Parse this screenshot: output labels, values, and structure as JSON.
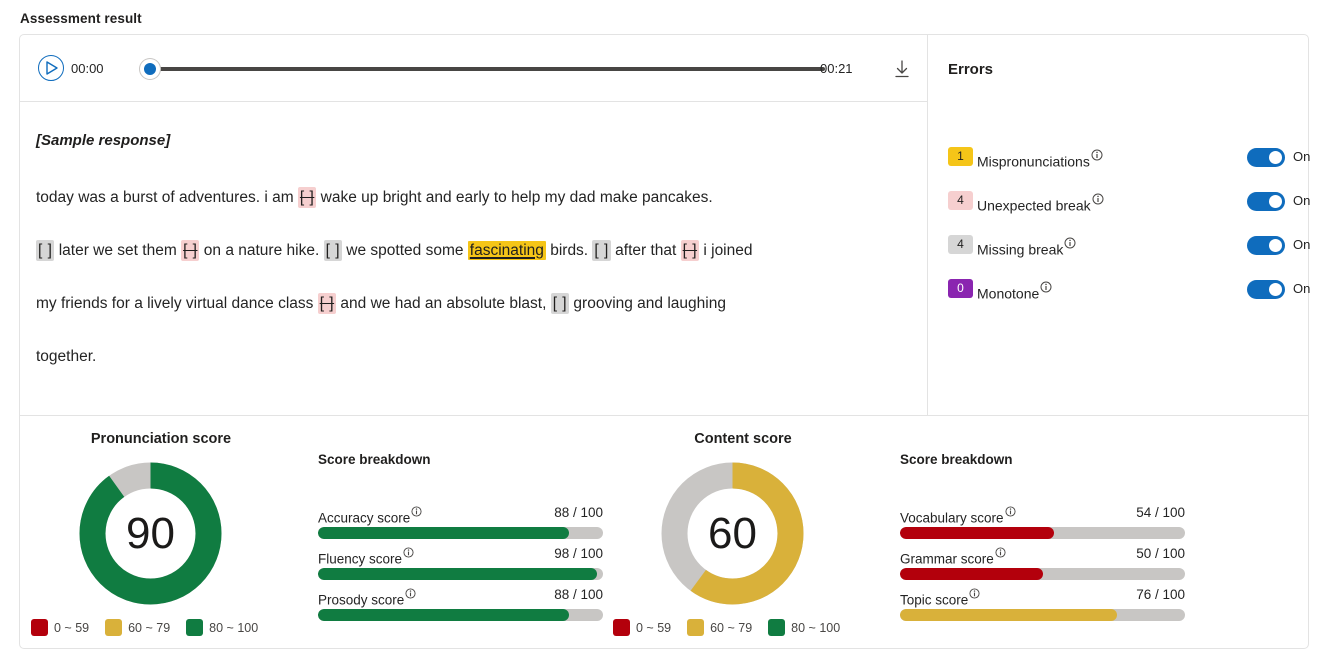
{
  "page_title": "Assessment result",
  "player": {
    "play_icon": "play-icon",
    "current_time": "00:00",
    "total_time": "00:21",
    "progress_percent": 0,
    "download_icon": "download-icon"
  },
  "transcript": {
    "sample_label": "[Sample response]",
    "lines": [
      [
        {
          "type": "text",
          "text": "today was a burst of adventures. i am "
        },
        {
          "type": "unexpected-break",
          "text": "[ ]"
        },
        {
          "type": "text",
          "text": " wake up bright and early to help my dad make pancakes."
        }
      ],
      [
        {
          "type": "missing-break",
          "text": "[ ]"
        },
        {
          "type": "text",
          "text": " later we set them "
        },
        {
          "type": "unexpected-break",
          "text": "[ ]"
        },
        {
          "type": "text",
          "text": " on a nature hike. "
        },
        {
          "type": "missing-break",
          "text": "[ ]"
        },
        {
          "type": "text",
          "text": " we spotted some "
        },
        {
          "type": "mispronunciation",
          "text": "fascinating"
        },
        {
          "type": "text",
          "text": " birds. "
        },
        {
          "type": "missing-break",
          "text": "[ ]"
        },
        {
          "type": "text",
          "text": " after that "
        },
        {
          "type": "unexpected-break",
          "text": "[ ]"
        },
        {
          "type": "text",
          "text": " i joined"
        }
      ],
      [
        {
          "type": "text",
          "text": "my friends for a lively virtual dance class "
        },
        {
          "type": "unexpected-break",
          "text": "[ ]"
        },
        {
          "type": "text",
          "text": " and we had an absolute blast, "
        },
        {
          "type": "missing-break",
          "text": "[ ]"
        },
        {
          "type": "text",
          "text": " grooving and laughing"
        }
      ],
      [
        {
          "type": "text",
          "text": "together."
        }
      ]
    ]
  },
  "errors": {
    "title": "Errors",
    "toggle_on_label": "On",
    "items": [
      {
        "count": "1",
        "label": "Mispronunciations",
        "badge_bg": "#f5c518",
        "badge_fg": "#201f1e",
        "toggle": "On"
      },
      {
        "count": "4",
        "label": "Unexpected break",
        "badge_bg": "#f6cfcf",
        "badge_fg": "#201f1e",
        "toggle": "On"
      },
      {
        "count": "4",
        "label": "Missing break",
        "badge_bg": "#d6d6d6",
        "badge_fg": "#201f1e",
        "toggle": "On"
      },
      {
        "count": "0",
        "label": "Monotone",
        "badge_bg": "#8a25b0",
        "badge_fg": "#ffffff",
        "toggle": "On"
      }
    ]
  },
  "legend": {
    "items": [
      {
        "label": "0 ~ 59",
        "color": "#b3000c"
      },
      {
        "label": "60 ~ 79",
        "color": "#d9b13a"
      },
      {
        "label": "80 ~ 100",
        "color": "#107c41"
      }
    ]
  },
  "colors": {
    "red": "#b3000c",
    "gold": "#d9b13a",
    "green": "#107c41",
    "track": "#c8c6c4",
    "accent": "#0f6cbd"
  },
  "chart_data": [
    {
      "type": "pie",
      "title": "Pronunciation score",
      "value": 90,
      "max": 100,
      "display_value": "90",
      "color": "#107c41",
      "track_color": "#c8c6c4",
      "legend_position": "bottom",
      "legend": [
        "0 ~ 59",
        "60 ~ 79",
        "80 ~ 100"
      ]
    },
    {
      "type": "bar",
      "title": "Score breakdown",
      "orientation": "horizontal",
      "categories": [
        "Accuracy score",
        "Fluency score",
        "Prosody score"
      ],
      "values": [
        88,
        98,
        88
      ],
      "value_labels": [
        "88 / 100",
        "98 / 100",
        "88 / 100"
      ],
      "bar_colors": [
        "#107c41",
        "#107c41",
        "#107c41"
      ],
      "xlim": [
        0,
        100
      ],
      "grid": false
    },
    {
      "type": "pie",
      "title": "Content score",
      "value": 60,
      "max": 100,
      "display_value": "60",
      "color": "#d9b13a",
      "track_color": "#c8c6c4",
      "legend_position": "bottom",
      "legend": [
        "0 ~ 59",
        "60 ~ 79",
        "80 ~ 100"
      ]
    },
    {
      "type": "bar",
      "title": "Score breakdown",
      "orientation": "horizontal",
      "categories": [
        "Vocabulary score",
        "Grammar score",
        "Topic score"
      ],
      "values": [
        54,
        50,
        76
      ],
      "value_labels": [
        "54 / 100",
        "50 / 100",
        "76 / 100"
      ],
      "bar_colors": [
        "#b3000c",
        "#b3000c",
        "#d9b13a"
      ],
      "xlim": [
        0,
        100
      ],
      "grid": false
    }
  ],
  "scores": {
    "pronunciation": {
      "title": "Pronunciation score",
      "value": "90",
      "breakdown_title": "Score breakdown",
      "rows": [
        {
          "name": "Accuracy score",
          "score": "88 / 100",
          "value": 88,
          "color": "#107c41"
        },
        {
          "name": "Fluency score",
          "score": "98 / 100",
          "value": 98,
          "color": "#107c41"
        },
        {
          "name": "Prosody score",
          "score": "88 / 100",
          "value": 88,
          "color": "#107c41"
        }
      ]
    },
    "content": {
      "title": "Content score",
      "value": "60",
      "breakdown_title": "Score breakdown",
      "rows": [
        {
          "name": "Vocabulary score",
          "score": "54 / 100",
          "value": 54,
          "color": "#b3000c"
        },
        {
          "name": "Grammar score",
          "score": "50 / 100",
          "value": 50,
          "color": "#b3000c"
        },
        {
          "name": "Topic score",
          "score": "76 / 100",
          "value": 76,
          "color": "#d9b13a"
        }
      ]
    }
  }
}
